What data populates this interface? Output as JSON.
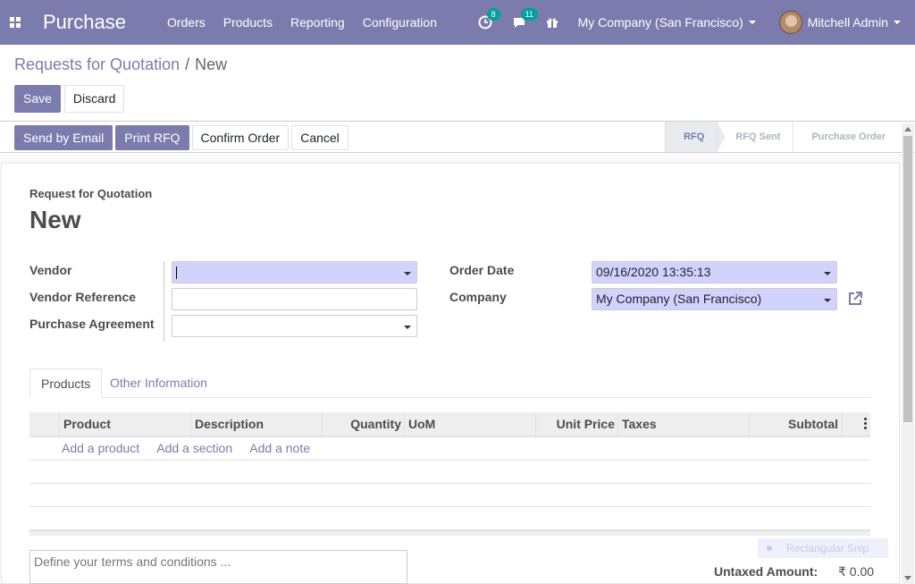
{
  "navbar": {
    "brand": "Purchase",
    "menu": [
      "Orders",
      "Products",
      "Reporting",
      "Configuration"
    ],
    "activity_count": "8",
    "messages_count": "11",
    "company": "My Company (San Francisco)",
    "user": "Mitchell Admin",
    "color": "#7c7bad"
  },
  "breadcrumb": {
    "parent": "Requests for Quotation",
    "separator": "/",
    "current": "New"
  },
  "buttons": {
    "save": "Save",
    "discard": "Discard"
  },
  "actions": {
    "send_email": "Send by Email",
    "print_rfq": "Print RFQ",
    "confirm": "Confirm Order",
    "cancel": "Cancel"
  },
  "stages": [
    "RFQ",
    "RFQ Sent",
    "Purchase Order"
  ],
  "form": {
    "title_label": "Request for Quotation",
    "title": "New",
    "vendor_label": "Vendor",
    "vendor_value": "",
    "vendor_ref_label": "Vendor Reference",
    "vendor_ref_value": "",
    "agreement_label": "Purchase Agreement",
    "agreement_value": "",
    "order_date_label": "Order Date",
    "order_date_value": "09/16/2020 13:35:13",
    "company_label": "Company",
    "company_value": "My Company (San Francisco)"
  },
  "tabs": [
    "Products",
    "Other Information"
  ],
  "table": {
    "columns": [
      "Product",
      "Description",
      "Quantity",
      "UoM",
      "Unit Price",
      "Taxes",
      "Subtotal"
    ],
    "add_product": "Add a product",
    "add_section": "Add a section",
    "add_note": "Add a note"
  },
  "notes_placeholder": "Define your terms and conditions ...",
  "totals": {
    "untaxed_label": "Untaxed Amount:",
    "untaxed_value": "₹ 0.00"
  },
  "overlay": {
    "snip_label": "Rectangular Snip"
  }
}
